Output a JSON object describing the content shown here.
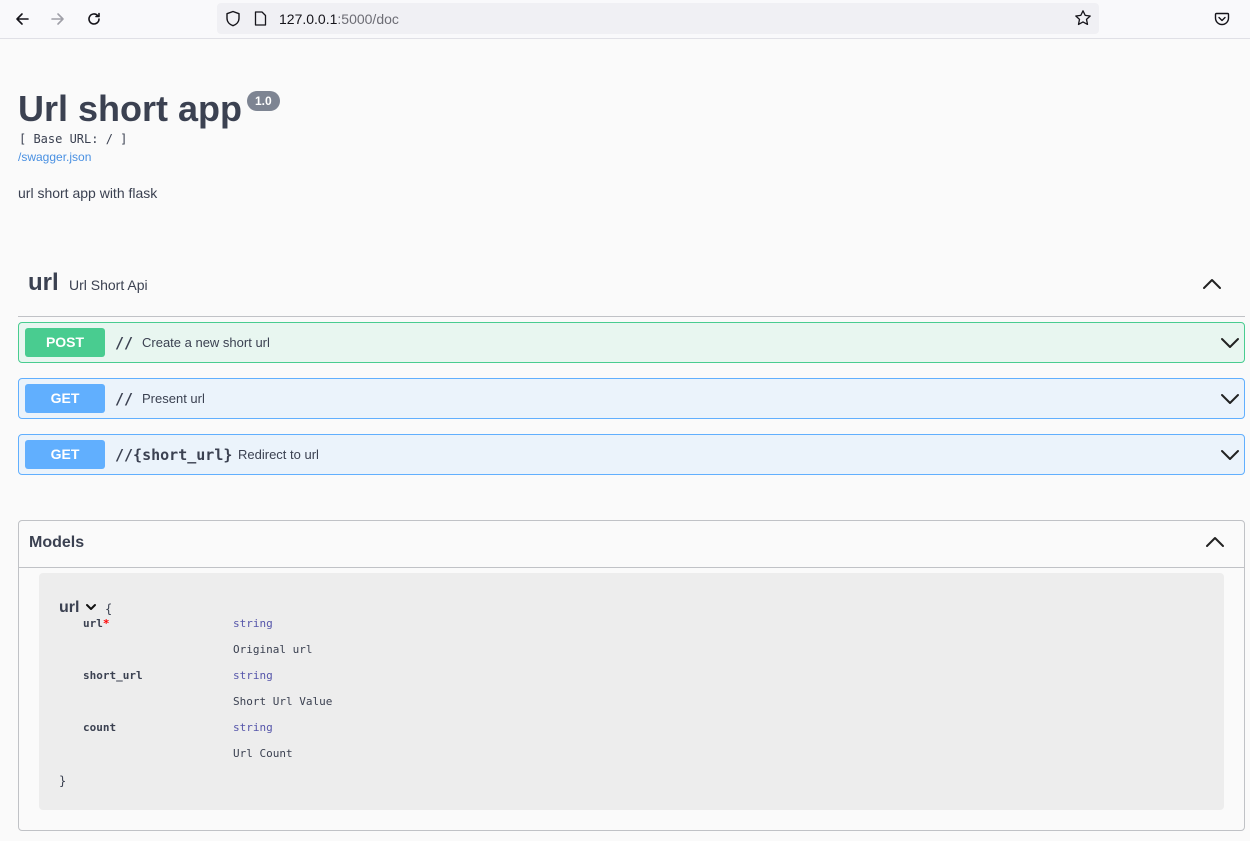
{
  "browser": {
    "url_host": "127.0.0.1",
    "url_rest": ":5000/doc"
  },
  "info": {
    "title": "Url short app",
    "version": "1.0",
    "base_url": "[ Base URL: / ]",
    "swagger_link": "/swagger.json",
    "description": "url short app with flask"
  },
  "tag": {
    "name": "url",
    "description": "Url Short Api"
  },
  "operations": [
    {
      "method": "POST",
      "path": "//",
      "summary": "Create a new short url"
    },
    {
      "method": "GET",
      "path": "//",
      "summary": "Present url"
    },
    {
      "method": "GET",
      "path": "//{short_url}",
      "summary": "Redirect to url"
    }
  ],
  "models": {
    "title": "Models",
    "model": {
      "name": "url",
      "open_brace": "{",
      "close_brace": "}",
      "properties": [
        {
          "name": "url",
          "required_mark": "*",
          "type": "string",
          "description": "Original url"
        },
        {
          "name": "short_url",
          "required_mark": "",
          "type": "string",
          "description": "Short Url Value"
        },
        {
          "name": "count",
          "required_mark": "",
          "type": "string",
          "description": "Url Count"
        }
      ]
    }
  },
  "colors": {
    "post": "#49cc90",
    "get": "#61affe",
    "text": "#3b4151",
    "link": "#4990e2"
  }
}
